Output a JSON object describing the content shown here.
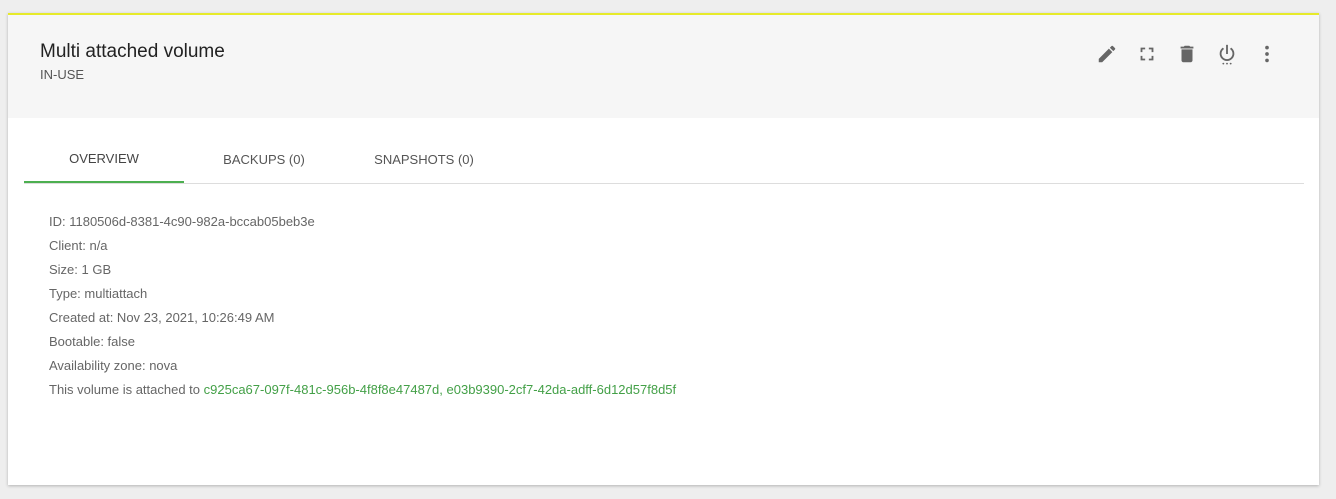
{
  "volume": {
    "title": "Multi attached volume",
    "status": "IN-USE"
  },
  "actions": [
    {
      "name": "edit-icon"
    },
    {
      "name": "fullscreen-icon"
    },
    {
      "name": "delete-icon"
    },
    {
      "name": "power-icon"
    },
    {
      "name": "more-vert-icon"
    }
  ],
  "tabs": [
    {
      "label": "OVERVIEW",
      "active": true
    },
    {
      "label": "BACKUPS (0)",
      "active": false
    },
    {
      "label": "SNAPSHOTS (0)",
      "active": false
    }
  ],
  "details": {
    "id": "ID: 1180506d-8381-4c90-982a-bccab05beb3e",
    "client": "Client: n/a",
    "size": "Size: 1 GB",
    "type": "Type: multiattach",
    "created": "Created at: Nov 23, 2021, 10:26:49 AM",
    "bootable": "Bootable: false",
    "zone": "Availability zone: nova",
    "attached_prefix": "This volume is attached to ",
    "attached_1": "c925ca67-097f-481c-956b-4f8f8e47487d",
    "separator": ", ",
    "attached_2": "e03b9390-2cf7-42da-adff-6d12d57f8d5f"
  },
  "colors": {
    "accent": "#4caf50",
    "link": "#43a047",
    "top_border": "#e6ea2a"
  }
}
